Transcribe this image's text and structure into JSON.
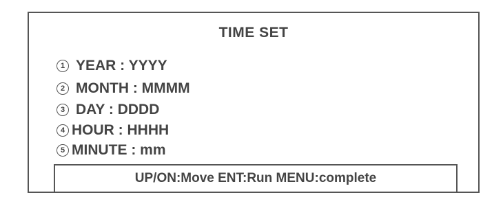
{
  "screen": {
    "title": "TIME SET",
    "items": [
      {
        "number": "1",
        "label": "YEAR : YYYY"
      },
      {
        "number": "2",
        "label": "MONTH : MMMM"
      },
      {
        "number": "3",
        "label": "DAY : DDDD"
      },
      {
        "number": "4",
        "label": "HOUR : HHHH"
      },
      {
        "number": "5",
        "label": "MINUTE : mm"
      }
    ],
    "help_text": "UP/ON:Move ENT:Run MENU:complete"
  }
}
